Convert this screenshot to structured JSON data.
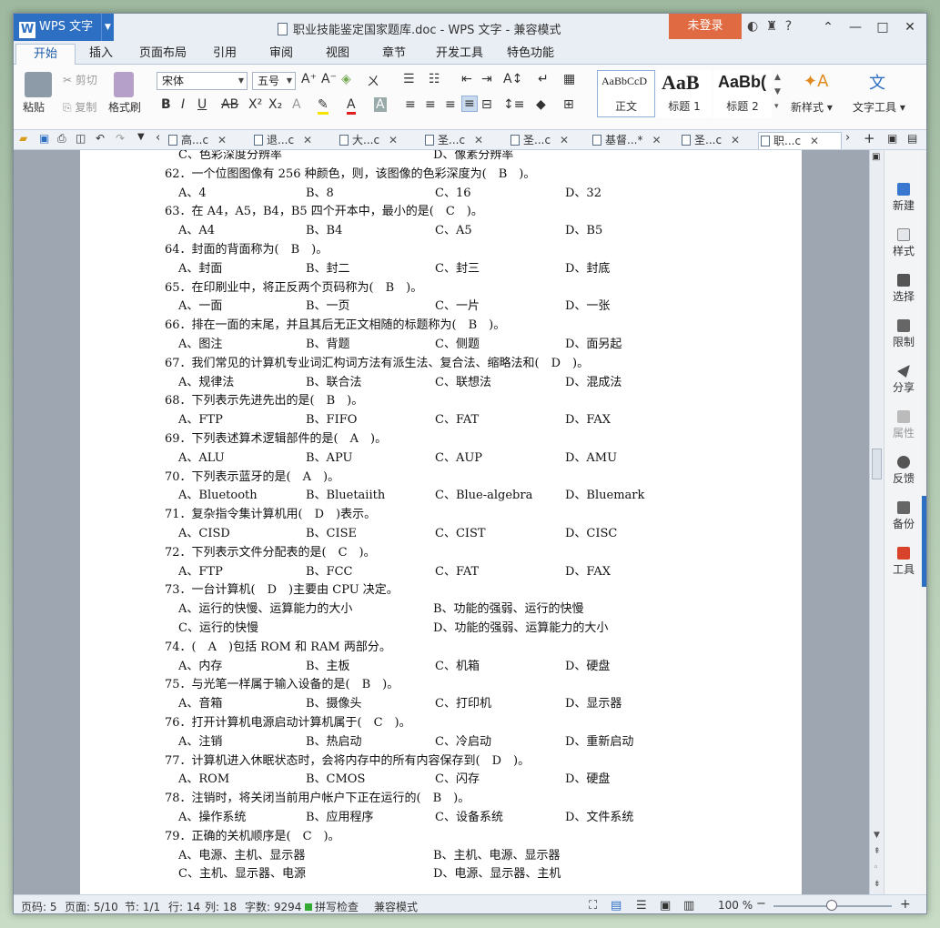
{
  "app": {
    "name": "WPS 文字",
    "window_title": "职业技能鉴定国家题库.doc - WPS 文字 - 兼容模式",
    "login_label": "未登录"
  },
  "menu_tabs": [
    "开始",
    "插入",
    "页面布局",
    "引用",
    "审阅",
    "视图",
    "章节",
    "开发工具",
    "特色功能"
  ],
  "ribbon": {
    "paste": "粘贴",
    "cut": "剪切",
    "copy": "复制",
    "format_painter": "格式刷",
    "font_name": "宋体",
    "font_size": "五号",
    "styles": [
      {
        "preview": "AaBbCcD",
        "label": "正文"
      },
      {
        "preview": "AaB",
        "label": "标题 1"
      },
      {
        "preview": "AaBb(",
        "label": "标题 2"
      }
    ],
    "new_style": "新样式",
    "text_tools": "文字工具"
  },
  "doc_tabs": [
    "高...c",
    "退...c",
    "大...c",
    "圣...c",
    "圣...c",
    "基督...*",
    "圣...c",
    "职...c"
  ],
  "document_lines": [
    [
      "C、色彩深度分辨率",
      "D、像素分辨率"
    ],
    [
      "62．一个位图图像有 256 种颜色，则，该图像的色彩深度为(　B　)。"
    ],
    [
      "A、4",
      "B、8",
      "C、16",
      "D、32"
    ],
    [
      "63．在 A4，A5，B4，B5 四个开本中，最小的是(　C　)。"
    ],
    [
      "A、A4",
      "B、B4",
      "C、A5",
      "D、B5"
    ],
    [
      "64．封面的背面称为(　B　)。"
    ],
    [
      "A、封面",
      "B、封二",
      "C、封三",
      "D、封底"
    ],
    [
      "65．在印刷业中，将正反两个页码称为(　B　)。"
    ],
    [
      "A、一面",
      "B、一页",
      "C、一片",
      "D、一张"
    ],
    [
      "66．排在一面的末尾，并且其后无正文相随的标题称为(　B　)。"
    ],
    [
      "A、图注",
      "B、背题",
      "C、侧题",
      "D、面另起"
    ],
    [
      "67．我们常见的计算机专业词汇构词方法有派生法、复合法、缩略法和(　D　)。"
    ],
    [
      "A、规律法",
      "B、联合法",
      "C、联想法",
      "D、混成法"
    ],
    [
      "68．下列表示先进先出的是(　B　)。"
    ],
    [
      "A、FTP",
      "B、FIFO",
      "C、FAT",
      "D、FAX"
    ],
    [
      "69．下列表述算术逻辑部件的是(　A　)。"
    ],
    [
      "A、ALU",
      "B、APU",
      "C、AUP",
      "D、AMU"
    ],
    [
      "70．下列表示蓝牙的是(　A　)。"
    ],
    [
      "A、Bluetooth",
      "B、Bluetaiith",
      "C、Blue-algebra",
      "D、Bluemark"
    ],
    [
      "71．复杂指令集计算机用(　D　)表示。"
    ],
    [
      "A、CISD",
      "B、CISE",
      "C、CIST",
      "D、CISC"
    ],
    [
      "72．下列表示文件分配表的是(　C　)。"
    ],
    [
      "A、FTP",
      "B、FCC",
      "C、FAT",
      "D、FAX"
    ],
    [
      "73．一台计算机(　D　)主要由 CPU 决定。"
    ],
    [
      "A、运行的快慢、运算能力的大小",
      "B、功能的强弱、运行的快慢"
    ],
    [
      "C、运行的快慢",
      "D、功能的强弱、运算能力的大小"
    ],
    [
      "74．(　A　)包括 ROM 和 RAM 两部分。"
    ],
    [
      "A、内存",
      "B、主板",
      "C、机箱",
      "D、硬盘"
    ],
    [
      "75．与光笔一样属于输入设备的是(　B　)。"
    ],
    [
      "A、音箱",
      "B、摄像头",
      "C、打印机",
      "D、显示器"
    ],
    [
      "76．打开计算机电源启动计算机属于(　C　)。"
    ],
    [
      "A、注销",
      "B、热启动",
      "C、冷启动",
      "D、重新启动"
    ],
    [
      "77．计算机进入休眠状态时，会将内存中的所有内容保存到(　D　)。"
    ],
    [
      "A、ROM",
      "B、CMOS",
      "C、闪存",
      "D、硬盘"
    ],
    [
      "78．注销时，将关闭当前用户帐户下正在运行的(　B　)。"
    ],
    [
      "A、操作系统",
      "B、应用程序",
      "C、设备系统",
      "D、文件系统"
    ],
    [
      "79．正确的关机顺序是(　C　)。"
    ],
    [
      "A、电源、主机、显示器",
      "B、主机、电源、显示器"
    ],
    [
      "C、主机、显示器、电源",
      "D、电源、显示器、主机"
    ]
  ],
  "right_panel": [
    "新建",
    "样式",
    "选择",
    "限制",
    "分享",
    "属性",
    "反馈",
    "备份",
    "工具"
  ],
  "status": {
    "page_code": "页码: 5",
    "pages": "页面: 5/10",
    "section": "节: 1/1",
    "row": "行: 14",
    "col": "列: 18",
    "words": "字数: 9294",
    "spell": "拼写检查",
    "compat": "兼容模式",
    "zoom": "100 %"
  },
  "colors": {
    "accent": "#2d6fc3",
    "login": "#e06a41"
  }
}
